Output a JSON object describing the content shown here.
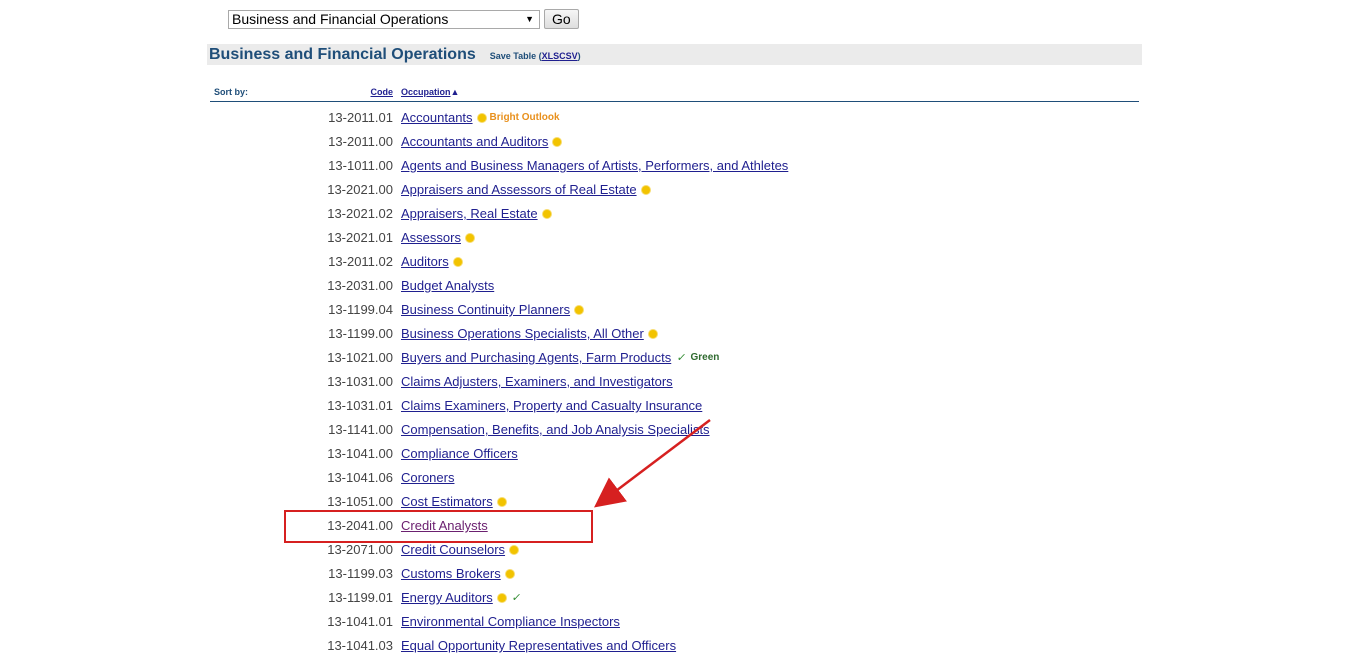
{
  "selector": {
    "selected": "Business and Financial Operations",
    "go_label": "Go"
  },
  "header": {
    "title": "Business and Financial Operations",
    "save_prefix": "Save Table (",
    "xls": "XLS",
    "csv": "CSV",
    "save_suffix": ")"
  },
  "sort": {
    "label": "Sort by:",
    "code": "Code",
    "occupation": "Occupation",
    "sort_glyph": "▲"
  },
  "annotations": {
    "highlight_color": "#d62020"
  },
  "rows": [
    {
      "code": "13-2011.01",
      "title": "Accountants",
      "bright": true,
      "bright_label": "Bright Outlook",
      "green": false
    },
    {
      "code": "13-2011.00",
      "title": "Accountants and Auditors",
      "bright": true,
      "green": false
    },
    {
      "code": "13-1011.00",
      "title": "Agents and Business Managers of Artists, Performers, and Athletes",
      "bright": false,
      "green": false
    },
    {
      "code": "13-2021.00",
      "title": "Appraisers and Assessors of Real Estate",
      "bright": true,
      "green": false
    },
    {
      "code": "13-2021.02",
      "title": "Appraisers, Real Estate",
      "bright": true,
      "green": false
    },
    {
      "code": "13-2021.01",
      "title": "Assessors",
      "bright": true,
      "green": false
    },
    {
      "code": "13-2011.02",
      "title": "Auditors",
      "bright": true,
      "green": false
    },
    {
      "code": "13-2031.00",
      "title": "Budget Analysts",
      "bright": false,
      "green": false
    },
    {
      "code": "13-1199.04",
      "title": "Business Continuity Planners",
      "bright": true,
      "green": false
    },
    {
      "code": "13-1199.00",
      "title": "Business Operations Specialists, All Other",
      "bright": true,
      "green": false
    },
    {
      "code": "13-1021.00",
      "title": "Buyers and Purchasing Agents, Farm Products",
      "bright": false,
      "green": true,
      "green_label": "Green"
    },
    {
      "code": "13-1031.00",
      "title": "Claims Adjusters, Examiners, and Investigators",
      "bright": false,
      "green": false
    },
    {
      "code": "13-1031.01",
      "title": "Claims Examiners, Property and Casualty Insurance",
      "bright": false,
      "green": false
    },
    {
      "code": "13-1141.00",
      "title": "Compensation, Benefits, and Job Analysis Specialists",
      "bright": false,
      "green": false
    },
    {
      "code": "13-1041.00",
      "title": "Compliance Officers",
      "bright": false,
      "green": false
    },
    {
      "code": "13-1041.06",
      "title": "Coroners",
      "bright": false,
      "green": false
    },
    {
      "code": "13-1051.00",
      "title": "Cost Estimators",
      "bright": true,
      "green": false
    },
    {
      "code": "13-2041.00",
      "title": "Credit Analysts",
      "bright": false,
      "green": false,
      "visited": true
    },
    {
      "code": "13-2071.00",
      "title": "Credit Counselors",
      "bright": true,
      "green": false
    },
    {
      "code": "13-1199.03",
      "title": "Customs Brokers",
      "bright": true,
      "green": false
    },
    {
      "code": "13-1199.01",
      "title": "Energy Auditors",
      "bright": true,
      "green": true
    },
    {
      "code": "13-1041.01",
      "title": "Environmental Compliance Inspectors",
      "bright": false,
      "green": false
    },
    {
      "code": "13-1041.03",
      "title": "Equal Opportunity Representatives and Officers",
      "bright": false,
      "green": false
    }
  ]
}
